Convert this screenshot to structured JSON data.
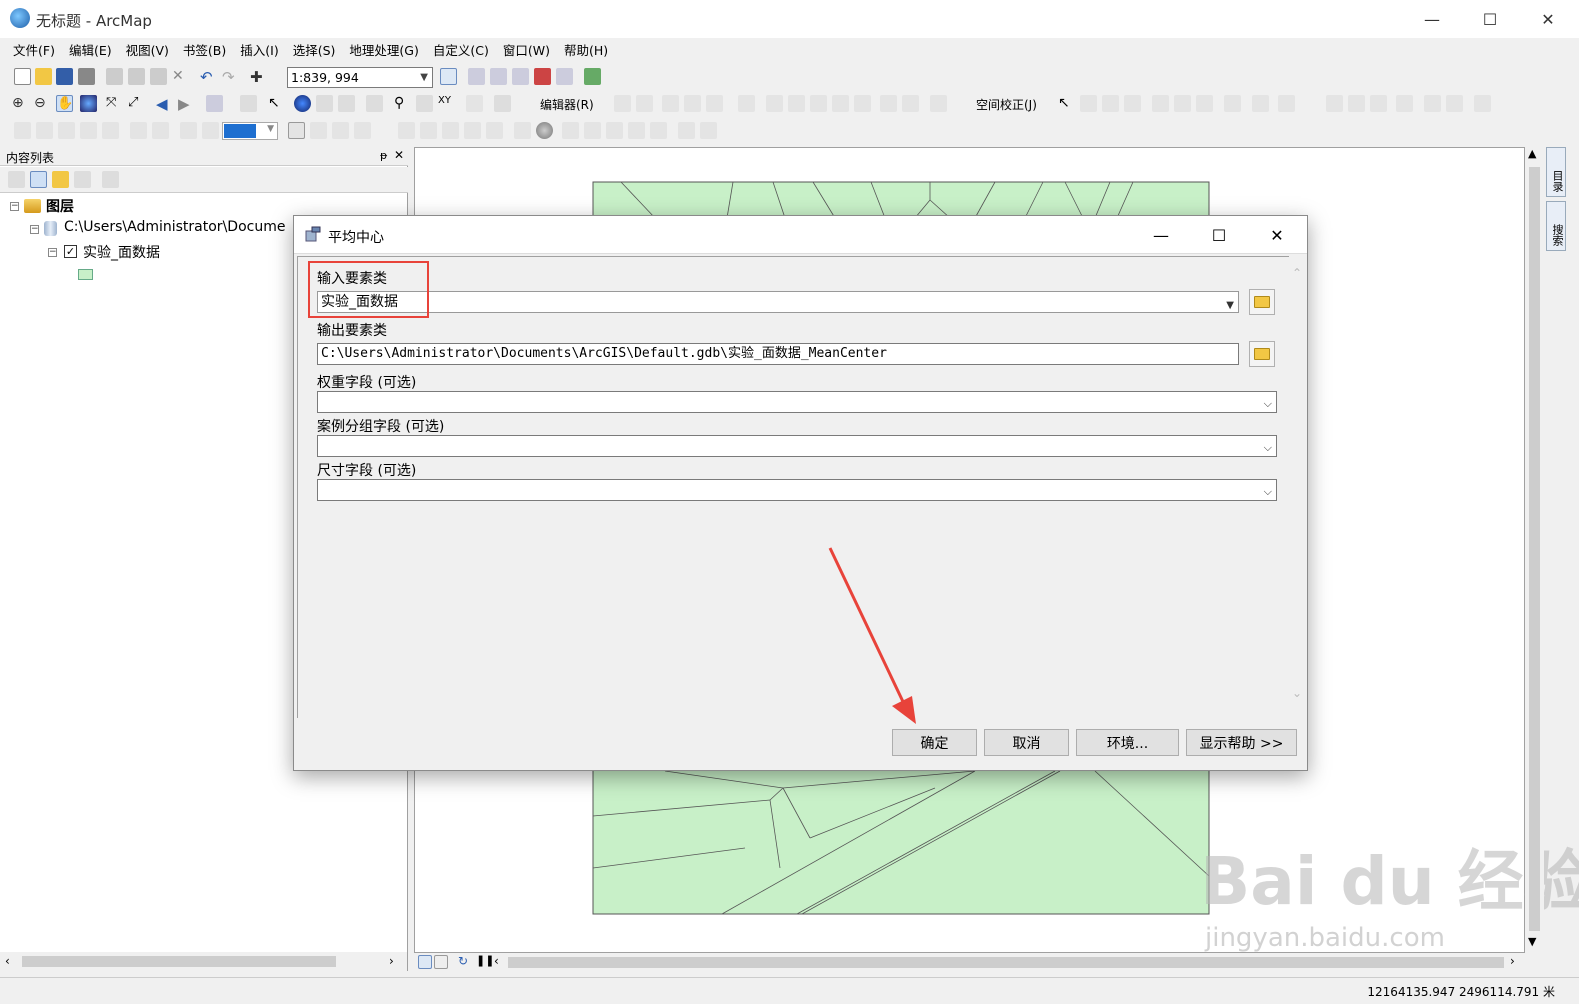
{
  "window": {
    "title": "无标题 - ArcMap",
    "minimize": "—",
    "maximize": "☐",
    "close": "✕"
  },
  "menu": [
    "文件(F)",
    "编辑(E)",
    "视图(V)",
    "书签(B)",
    "插入(I)",
    "选择(S)",
    "地理处理(G)",
    "自定义(C)",
    "窗口(W)",
    "帮助(H)"
  ],
  "toolbar": {
    "scale": "1:839, 994",
    "editor_label": "编辑器(R)",
    "spatial_adjust_label": "空间校正(J)"
  },
  "toc": {
    "title": "内容列表",
    "pin": "ᵽ",
    "close": "✕",
    "root_label": "图层",
    "database_path": "C:\\Users\\Administrator\\Docume",
    "layer_label": "实验_面数据",
    "layer_checked": true
  },
  "side_tabs": [
    "目录",
    "搜索"
  ],
  "status": {
    "coords": "12164135.947  2496114.791 米"
  },
  "dialog": {
    "title": "平均中心",
    "minimize": "—",
    "maximize": "☐",
    "close": "✕",
    "fields": {
      "input_label": "输入要素类",
      "input_value": "实验_面数据",
      "output_label": "输出要素类",
      "output_value": "C:\\Users\\Administrator\\Documents\\ArcGIS\\Default.gdb\\实验_面数据_MeanCenter",
      "weight_label": "权重字段 (可选)",
      "weight_value": "",
      "case_label": "案例分组字段 (可选)",
      "case_value": "",
      "dimension_label": "尺寸字段 (可选)",
      "dimension_value": ""
    },
    "buttons": {
      "ok": "确定",
      "cancel": "取消",
      "env": "环境...",
      "help": "显示帮助 >>"
    }
  },
  "colors": {
    "map_fill": "#c8f0c8",
    "highlight": "#e8433a",
    "arrow": "#e8433a"
  },
  "watermark": {
    "brand": "Bai du 经验",
    "url": "jingyan.baidu.com"
  }
}
